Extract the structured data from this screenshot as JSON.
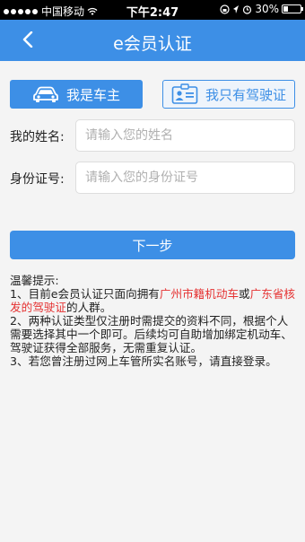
{
  "status_bar": {
    "carrier": "中国移动",
    "time": "下午2:47",
    "battery_percent": "30%",
    "battery_level": 0.3
  },
  "nav": {
    "title": "e会员认证"
  },
  "types": {
    "owner_label": "我是车主",
    "license_label": "我只有驾驶证"
  },
  "form": {
    "name_label": "我的姓名:",
    "name_placeholder": "请输入您的姓名",
    "name_value": "",
    "id_label": "身份证号:",
    "id_placeholder": "请输入您的身份证号",
    "id_value": ""
  },
  "next_label": "下一步",
  "tips": {
    "heading": "温馨提示:",
    "item1_prefix": "1、目前e会员认证只面向拥有",
    "item1_red1": "广州市籍机动车",
    "item1_mid": "或",
    "item1_red2": "广东省核发的驾驶证",
    "item1_suffix": "的人群。",
    "item2": "2、两种认证类型仅注册时需提交的资料不同，根据个人需要选择其中一个即可。后续均可自助增加绑定机动车、驾驶证获得全部服务，无需重复认证。",
    "item3": "3、若您曾注册过网上车管所实名账号，请直接登录。"
  },
  "colors": {
    "accent": "#3d8fe6",
    "highlight": "#e53333"
  }
}
